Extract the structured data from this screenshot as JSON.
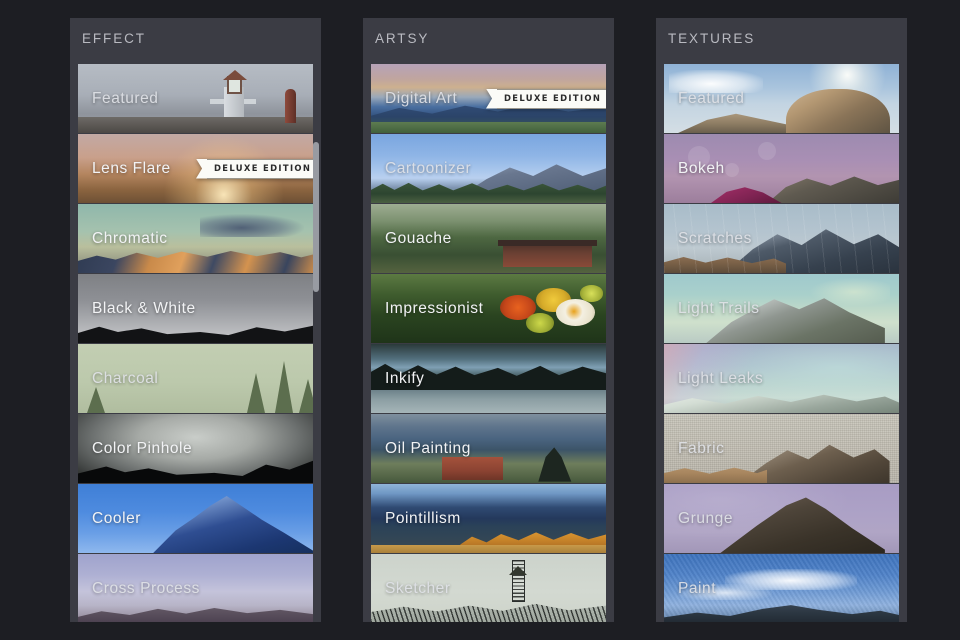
{
  "app": {
    "background_color": "#1d1e23",
    "panel_color": "#3b3c44",
    "badge_label": "DELUXE EDITION"
  },
  "panels": [
    {
      "header": "EFFECT",
      "scrollbar": {
        "visible": true,
        "orientation": "vertical",
        "thumb_top_pct": 14,
        "thumb_height_pct": 27
      },
      "items": [
        {
          "label": "Featured",
          "badge": null
        },
        {
          "label": "Lens Flare",
          "badge": "DELUXE EDITION"
        },
        {
          "label": "Chromatic",
          "badge": null
        },
        {
          "label": "Black & White",
          "badge": null
        },
        {
          "label": "Charcoal",
          "badge": null
        },
        {
          "label": "Color Pinhole",
          "badge": null
        },
        {
          "label": "Cooler",
          "badge": null
        },
        {
          "label": "Cross Process",
          "badge": null
        }
      ]
    },
    {
      "header": "ARTSY",
      "scrollbar": {
        "visible": false,
        "orientation": "vertical",
        "thumb_top_pct": 0,
        "thumb_height_pct": 0
      },
      "items": [
        {
          "label": "Digital Art",
          "badge": "DELUXE EDITION"
        },
        {
          "label": "Cartoonizer",
          "badge": null
        },
        {
          "label": "Gouache",
          "badge": null
        },
        {
          "label": "Impressionist",
          "badge": null
        },
        {
          "label": "Inkify",
          "badge": null
        },
        {
          "label": "Oil Painting",
          "badge": null
        },
        {
          "label": "Pointillism",
          "badge": null
        },
        {
          "label": "Sketcher",
          "badge": null
        }
      ]
    },
    {
      "header": "TEXTURES",
      "scrollbar": {
        "visible": false,
        "orientation": "vertical",
        "thumb_top_pct": 0,
        "thumb_height_pct": 0
      },
      "items": [
        {
          "label": "Featured",
          "badge": null
        },
        {
          "label": "Bokeh",
          "badge": null
        },
        {
          "label": "Scratches",
          "badge": null
        },
        {
          "label": "Light Trails",
          "badge": null
        },
        {
          "label": "Light Leaks",
          "badge": null
        },
        {
          "label": "Fabric",
          "badge": null
        },
        {
          "label": "Grunge",
          "badge": null
        },
        {
          "label": "Paint",
          "badge": null
        }
      ]
    }
  ]
}
